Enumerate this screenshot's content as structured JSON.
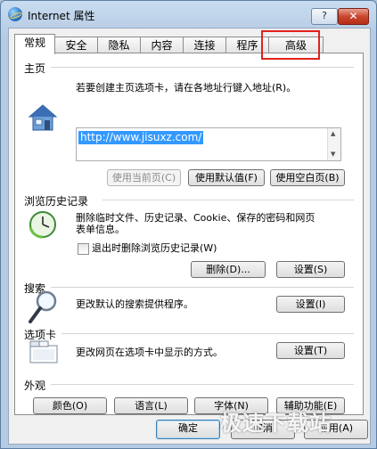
{
  "window": {
    "title": "Internet 属性",
    "help_label": "?",
    "close_label": "✕"
  },
  "tabs": [
    "常规",
    "安全",
    "隐私",
    "内容",
    "连接",
    "程序",
    "高级"
  ],
  "home": {
    "title": "主页",
    "description": "若要创建主页选项卡，请在各地址行键入地址(R)。",
    "url": "http://www.jisuxz.com/",
    "buttons": {
      "use_current": "使用当前页(C)",
      "use_default": "使用默认值(F)",
      "use_blank": "使用空白页(B)"
    }
  },
  "history": {
    "title": "浏览历史记录",
    "description_line1": "删除临时文件、历史记录、Cookie、保存的密码和网页",
    "description_line2": "表单信息。",
    "checkbox_label": "退出时删除浏览历史记录(W)",
    "checkbox_checked": false,
    "buttons": {
      "delete": "删除(D)...",
      "settings": "设置(S)"
    }
  },
  "search": {
    "title": "搜索",
    "description": "更改默认的搜索提供程序。",
    "settings": "设置(I)"
  },
  "tabs_group": {
    "title": "选项卡",
    "description": "更改网页在选项卡中显示的方式。",
    "settings": "设置(T)"
  },
  "appearance": {
    "title": "外观",
    "buttons": {
      "colors": "颜色(O)",
      "languages": "语言(L)",
      "fonts": "字体(N)",
      "accessibility": "辅助功能(E)"
    }
  },
  "footer": {
    "ok": "确定",
    "cancel": "取消",
    "apply": "应用(A)"
  },
  "watermark": "极速下载站",
  "icons": [
    "internet-options-icon",
    "house-icon",
    "history-clock-icon",
    "magnifier-icon",
    "tabs-icon"
  ]
}
